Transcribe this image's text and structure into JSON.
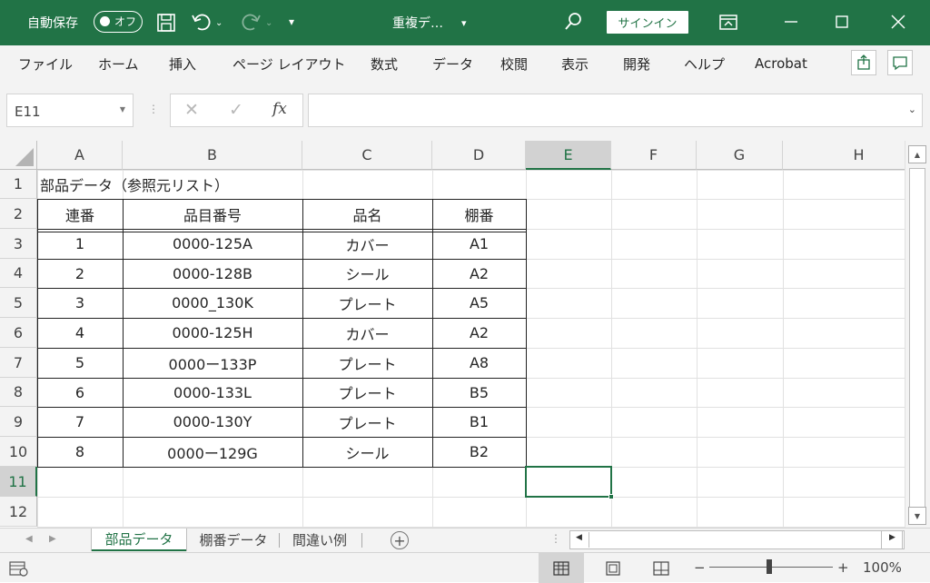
{
  "titlebar": {
    "autosave_label": "自動保存",
    "autosave_state": "オフ",
    "doc_title": "重複デ…",
    "signin_label": "サインイン",
    "icons": [
      "save-icon",
      "undo-icon",
      "redo-icon",
      "customize-qat-icon",
      "search-icon",
      "ribbon-display-icon",
      "minimize-icon",
      "maximize-icon",
      "close-icon"
    ]
  },
  "ribbon": {
    "tabs": [
      "ファイル",
      "ホーム",
      "挿入",
      "ページ レイアウト",
      "数式",
      "データ",
      "校閲",
      "表示",
      "開発",
      "ヘルプ",
      "Acrobat"
    ]
  },
  "formula": {
    "namebox": "E11",
    "cancel": "✕",
    "enter": "✓",
    "fx": "fx",
    "value": ""
  },
  "grid": {
    "columns": [
      "A",
      "B",
      "C",
      "D",
      "E",
      "F",
      "G",
      "H"
    ],
    "rows": [
      "1",
      "2",
      "3",
      "4",
      "5",
      "6",
      "7",
      "8",
      "9",
      "10",
      "11",
      "12"
    ],
    "selected_cell": "E11",
    "title_cell": "部品データ（参照元リスト）",
    "table_headers": [
      "連番",
      "品目番号",
      "品名",
      "棚番"
    ],
    "table_rows": [
      [
        "1",
        "0000-125A",
        "カバー",
        "A1"
      ],
      [
        "2",
        "0000-128B",
        "シール",
        "A2"
      ],
      [
        "3",
        "0000_130K",
        "プレート",
        "A5"
      ],
      [
        "4",
        "0000-125H",
        "カバー",
        "A2"
      ],
      [
        "5",
        "0000ー133P",
        "プレート",
        "A8"
      ],
      [
        "6",
        "0000-133L",
        "プレート",
        "B5"
      ],
      [
        "7",
        "0000-130Y",
        "プレート",
        "B1"
      ],
      [
        "8",
        "0000ー129G",
        "シール",
        "B2"
      ]
    ]
  },
  "sheets": {
    "tabs": [
      "部品データ",
      "棚番データ",
      "間違い例"
    ],
    "active": "部品データ"
  },
  "status": {
    "zoom_minus": "−",
    "zoom_plus": "+",
    "zoom_level": "100%"
  },
  "colors": {
    "accent": "#217346",
    "ribbon_bg": "#f3f3f3"
  }
}
